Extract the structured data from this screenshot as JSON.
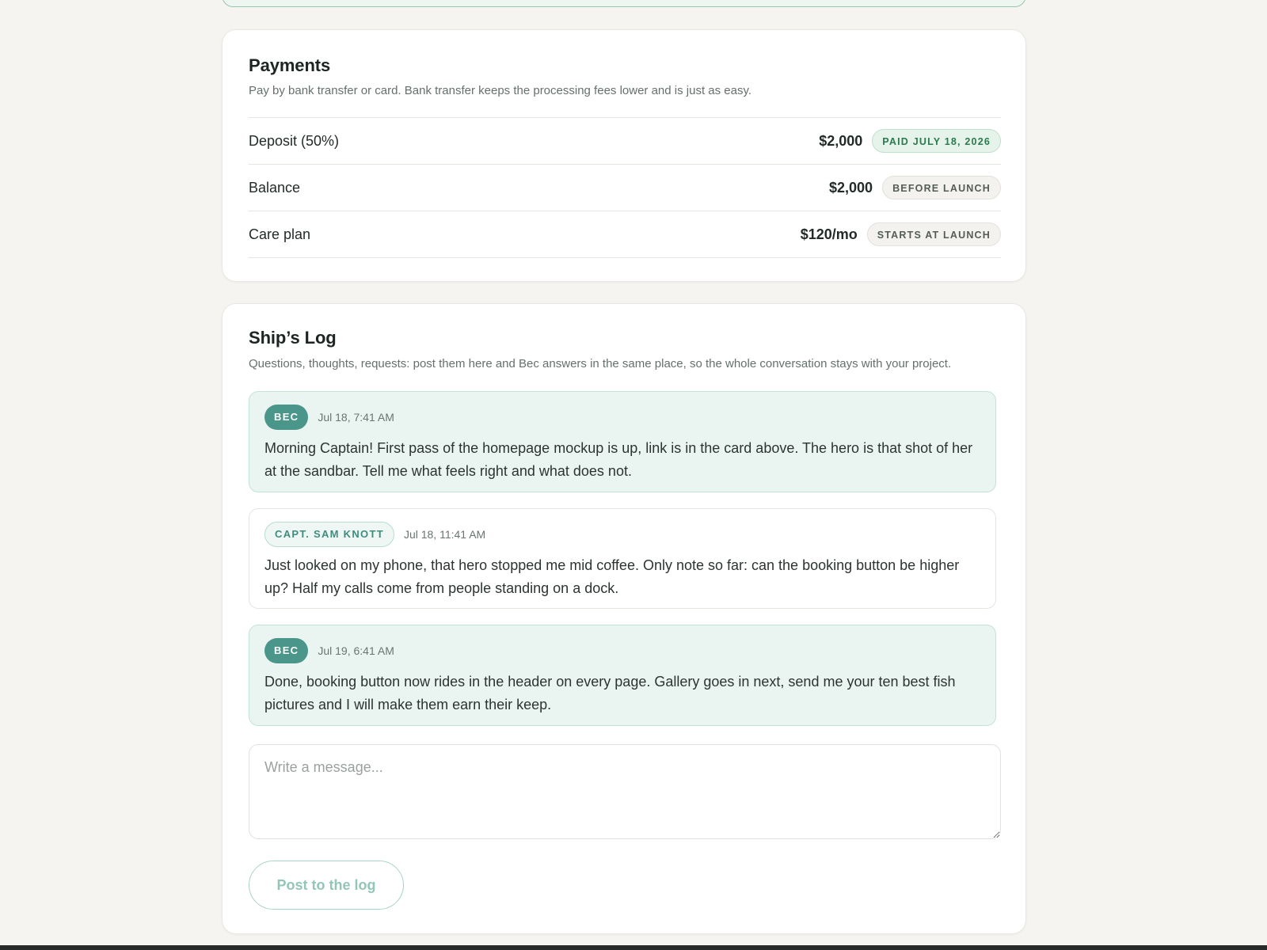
{
  "payments": {
    "title": "Payments",
    "subtitle": "Pay by bank transfer or card. Bank transfer keeps the processing fees lower and is just as easy.",
    "rows": [
      {
        "label": "Deposit (50%)",
        "amount": "$2,000",
        "status": "PAID JULY 18, 2026",
        "status_kind": "paid"
      },
      {
        "label": "Balance",
        "amount": "$2,000",
        "status": "BEFORE LAUNCH",
        "status_kind": "pending"
      },
      {
        "label": "Care plan",
        "amount": "$120/mo",
        "status": "STARTS AT LAUNCH",
        "status_kind": "pending"
      }
    ]
  },
  "log": {
    "title": "Ship’s Log",
    "subtitle": "Questions, thoughts, requests: post them here and Bec answers in the same place, so the whole conversation stays with your project.",
    "messages": [
      {
        "author": "BEC",
        "time": "Jul 18, 7:41 AM",
        "body": "Morning Captain! First pass of the homepage mockup is up, link is in the card above. The hero is that shot of her at the sandbar. Tell me what feels right and what does not."
      },
      {
        "author": "CAPT. SAM KNOTT",
        "time": "Jul 18, 11:41 AM",
        "body": "Just looked on my phone, that hero stopped me mid coffee. Only note so far: can the booking button be higher up? Half my calls come from people standing on a dock."
      },
      {
        "author": "BEC",
        "time": "Jul 19, 6:41 AM",
        "body": "Done, booking button now rides in the header on every page. Gallery goes in next, send me your ten best fish pictures and I will make them earn their keep."
      }
    ],
    "composer_placeholder": "Write a message...",
    "post_label": "Post to the log"
  },
  "colors": {
    "accent": "#4b968a",
    "paid": "#2c7a4e",
    "background": "#f5f4f1"
  }
}
